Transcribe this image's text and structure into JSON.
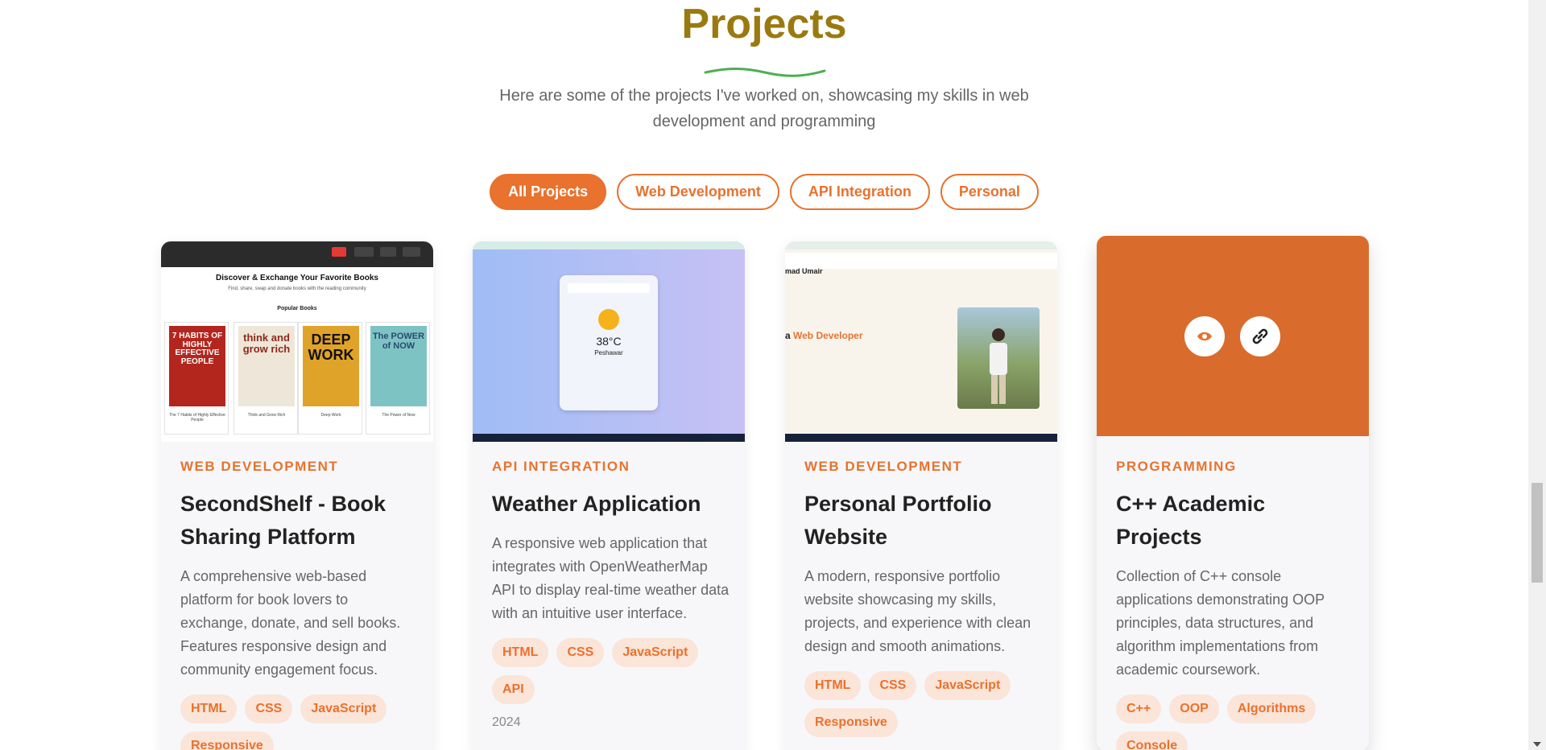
{
  "section": {
    "title": "Projects",
    "subtitle": "Here are some of the projects I've worked on, showcasing my skills in web development and programming"
  },
  "filters": [
    "All Projects",
    "Web Development",
    "API Integration",
    "Personal"
  ],
  "projects": [
    {
      "category": "WEB DEVELOPMENT",
      "title": "SecondShelf - Book Sharing Platform",
      "description": "A comprehensive web-based platform for book lovers to exchange, donate, and sell books. Features responsive design and community engagement focus.",
      "tags": [
        "HTML",
        "CSS",
        "JavaScript",
        "Responsive"
      ],
      "thumb": {
        "heading": "Discover & Exchange Your Favorite Books",
        "subheading": "Find, share, swap and donate books with the reading community",
        "popular": "Popular Books",
        "books": [
          {
            "cover": "7 HABITS OF HIGHLY EFFECTIVE PEOPLE",
            "caption": "The 7 Habits of Highly Effective People"
          },
          {
            "cover": "think and grow rich",
            "caption": "Think and Grow Rich"
          },
          {
            "cover": "DEEP WORK",
            "caption": "Deep Work"
          },
          {
            "cover": "The POWER of NOW",
            "caption": "The Power of Now"
          }
        ]
      }
    },
    {
      "category": "API INTEGRATION",
      "title": "Weather Application",
      "description": "A responsive web application that integrates with OpenWeatherMap API to display real-time weather data with an intuitive user interface.",
      "tags": [
        "HTML",
        "CSS",
        "JavaScript",
        "API"
      ],
      "year": "2024",
      "thumb": {
        "temp": "38°C",
        "city": "Peshawar"
      }
    },
    {
      "category": "WEB DEVELOPMENT",
      "title": "Personal Portfolio Website",
      "description": "A modern, responsive portfolio website showcasing my skills, projects, and experience with clean design and smooth animations.",
      "tags": [
        "HTML",
        "CSS",
        "JavaScript",
        "Responsive"
      ],
      "thumb": {
        "name": "mad Umair",
        "hero_prefix": "a ",
        "hero_highlight": "Web Developer"
      }
    },
    {
      "category": "PROGRAMMING",
      "title": "C++ Academic Projects",
      "description": "Collection of C++ console applications demonstrating OOP principles, data structures, and algorithm implementations from academic coursework.",
      "tags": [
        "C++",
        "OOP",
        "Algorithms",
        "Console"
      ],
      "thumb": {
        "overlay_icons": [
          "eye-icon",
          "link-icon"
        ]
      }
    }
  ],
  "colors": {
    "accent": "#e8722e",
    "title": "#9a7a10",
    "squiggle": "#4caf50"
  }
}
